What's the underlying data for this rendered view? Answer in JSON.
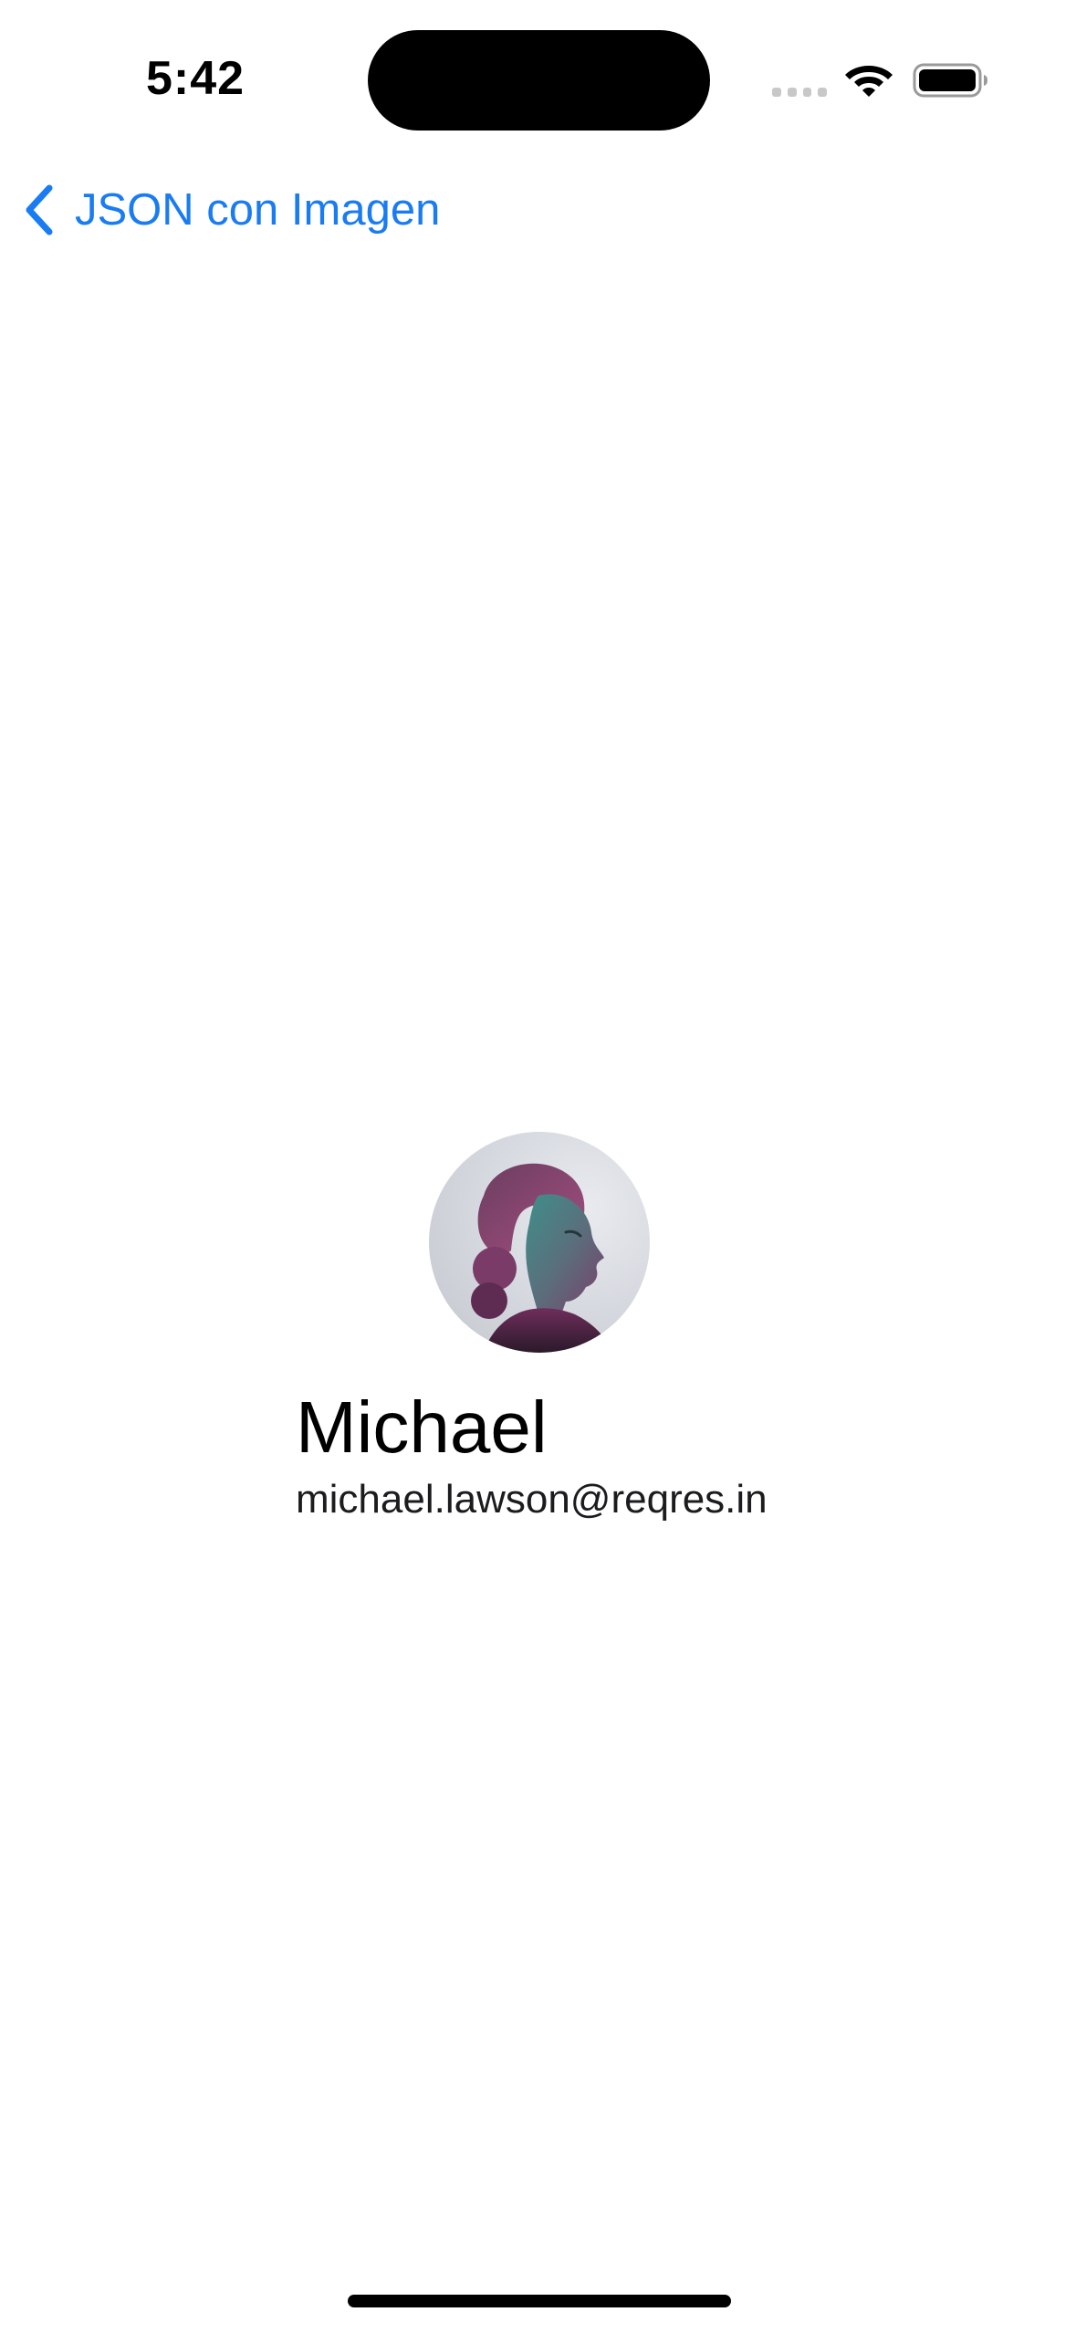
{
  "status_bar": {
    "time": "5:42",
    "icons": [
      "cellular-signal-icon",
      "wifi-icon",
      "battery-icon"
    ]
  },
  "navigation": {
    "back_label": "JSON con Imagen",
    "back_icon": "chevron-left-icon",
    "accent_color": "#1a7cf2"
  },
  "profile": {
    "avatar_icon": "user-avatar-photo",
    "name": "Michael",
    "email": "michael.lawson@reqres.in"
  }
}
